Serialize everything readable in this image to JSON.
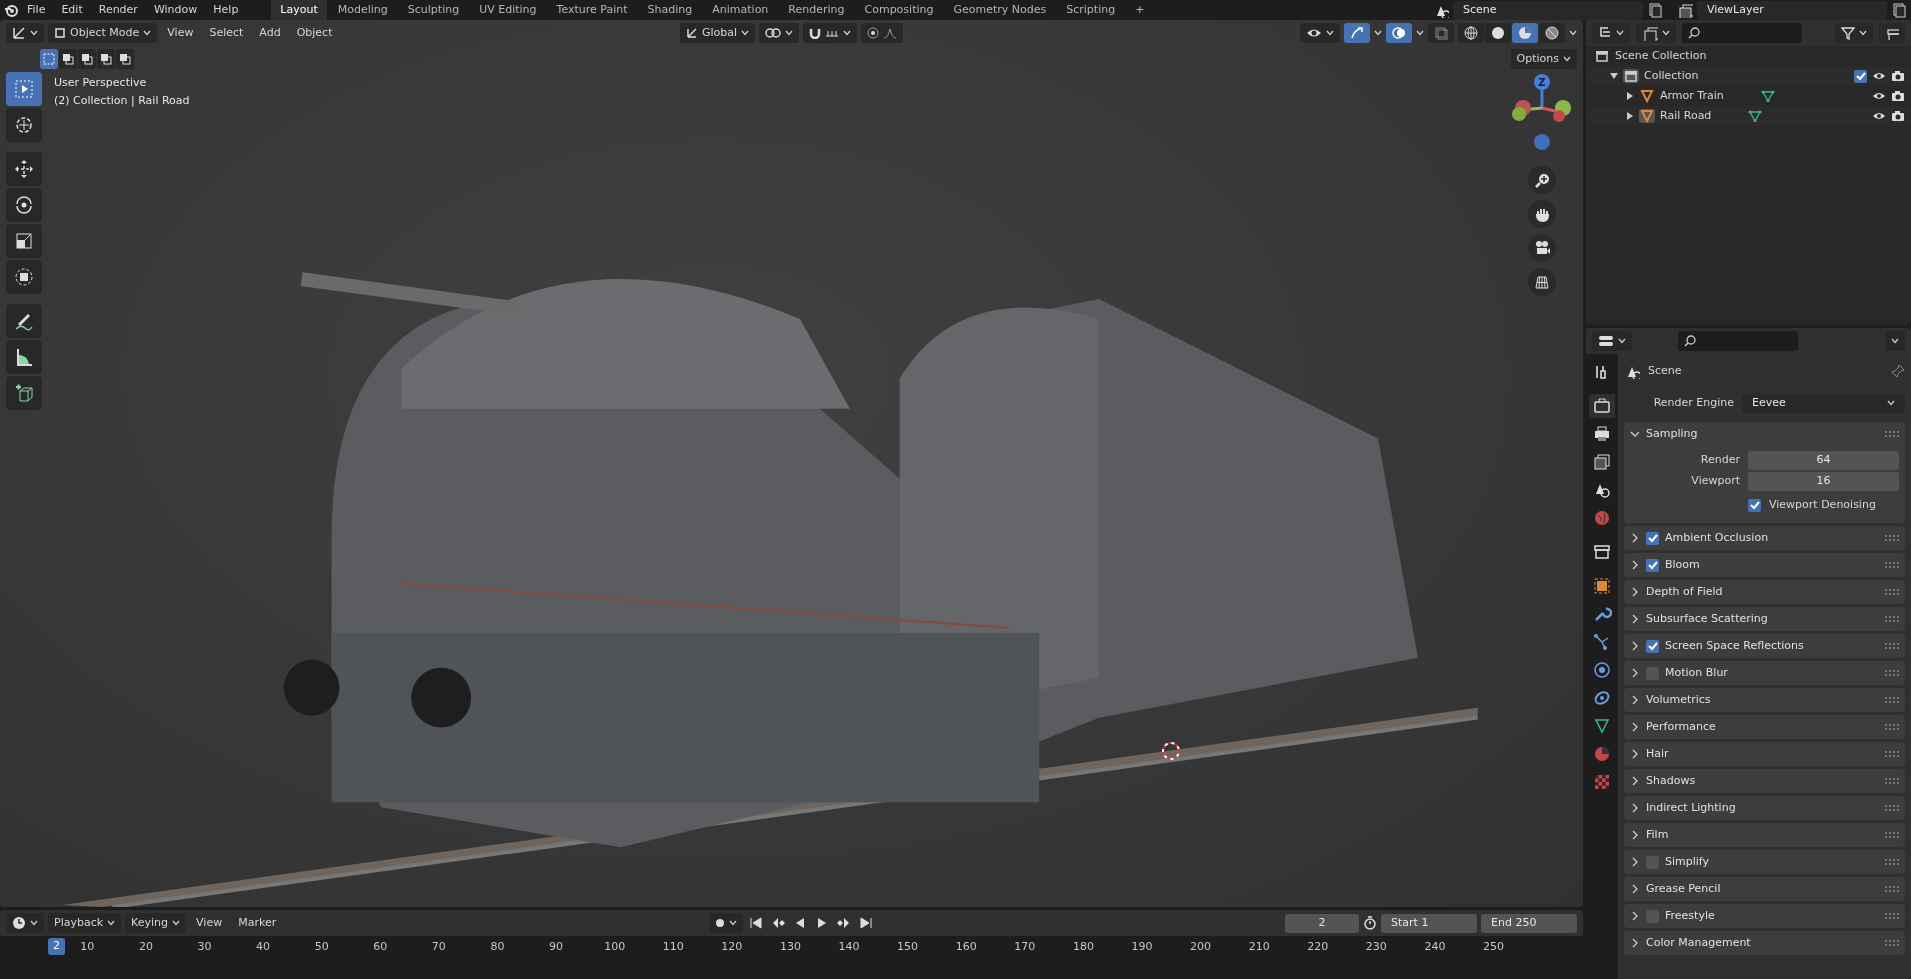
{
  "menu": [
    "File",
    "Edit",
    "Render",
    "Window",
    "Help"
  ],
  "workspaces": [
    {
      "label": "Layout",
      "selected": true
    },
    {
      "label": "Modeling",
      "selected": false
    },
    {
      "label": "Sculpting",
      "selected": false
    },
    {
      "label": "UV Editing",
      "selected": false
    },
    {
      "label": "Texture Paint",
      "selected": false
    },
    {
      "label": "Shading",
      "selected": false
    },
    {
      "label": "Animation",
      "selected": false
    },
    {
      "label": "Rendering",
      "selected": false
    },
    {
      "label": "Compositing",
      "selected": false
    },
    {
      "label": "Geometry Nodes",
      "selected": false
    },
    {
      "label": "Scripting",
      "selected": false
    }
  ],
  "add_workspace": "+",
  "scene": "Scene",
  "view_layer": "ViewLayer",
  "viewport": {
    "mode": "Object Mode",
    "menus": [
      "View",
      "Select",
      "Add",
      "Object"
    ],
    "orientation": "Global",
    "options": "Options",
    "overlay_lines": [
      "User Perspective",
      "(2) Collection | Rail Road"
    ],
    "select_modes": [
      {
        "selected": true
      },
      {
        "selected": false
      },
      {
        "selected": false
      },
      {
        "selected": false
      },
      {
        "selected": false
      }
    ],
    "gizmo_selected": true,
    "overlays_selected": true,
    "shading": [
      {
        "selected": false
      },
      {
        "selected": false
      },
      {
        "selected": true
      },
      {
        "selected": false
      }
    ],
    "tools": [
      {
        "kind": "select",
        "selected": true
      },
      {
        "kind": "cursor",
        "selected": false
      },
      {
        "kind": "move",
        "selected": false
      },
      {
        "kind": "rotate",
        "selected": false
      },
      {
        "kind": "scale",
        "selected": false
      },
      {
        "kind": "transform",
        "selected": false
      },
      {
        "kind": "annotate",
        "selected": false
      },
      {
        "kind": "measure",
        "selected": false
      },
      {
        "kind": "addcube",
        "selected": false
      }
    ],
    "gizmo_axis": "Z"
  },
  "outliner": {
    "items": [
      {
        "label": "Scene Collection",
        "children": [
          {
            "label": "Collection",
            "expanded": true,
            "checked": true,
            "children": [
              {
                "label": "Armor Train",
                "expanded": false,
                "selected": false
              },
              {
                "label": "Rail Road",
                "expanded": false,
                "selected": true
              }
            ]
          }
        ]
      }
    ]
  },
  "properties": {
    "tabs": [
      {
        "kind": "tool",
        "selected": false
      },
      {
        "kind": "render",
        "selected": true
      },
      {
        "kind": "output",
        "selected": false
      },
      {
        "kind": "viewlayer",
        "selected": false
      },
      {
        "kind": "scene",
        "selected": false
      },
      {
        "kind": "world",
        "selected": false
      },
      {
        "kind": "collection",
        "selected": false
      },
      {
        "kind": "object",
        "selected": false
      },
      {
        "kind": "modifier",
        "selected": false
      },
      {
        "kind": "particles",
        "selected": false
      },
      {
        "kind": "physics",
        "selected": false
      },
      {
        "kind": "constraint",
        "selected": false
      },
      {
        "kind": "data",
        "selected": false
      },
      {
        "kind": "material",
        "selected": false
      },
      {
        "kind": "texture",
        "selected": false
      }
    ],
    "context": "Scene",
    "render_engine": {
      "label": "Render Engine",
      "value": "Eevee"
    },
    "panels": [
      {
        "title": "Sampling",
        "expanded": true,
        "fields": [
          {
            "label": "Render",
            "value": "64"
          },
          {
            "label": "Viewport",
            "value": "16"
          }
        ],
        "option": {
          "label": "Viewport Denoising",
          "checked": true
        }
      },
      {
        "title": "Ambient Occlusion",
        "expanded": false,
        "checked": true
      },
      {
        "title": "Bloom",
        "expanded": false,
        "checked": true
      },
      {
        "title": "Depth of Field",
        "expanded": false
      },
      {
        "title": "Subsurface Scattering",
        "expanded": false
      },
      {
        "title": "Screen Space Reflections",
        "expanded": false,
        "checked": true
      },
      {
        "title": "Motion Blur",
        "expanded": false,
        "checked": false
      },
      {
        "title": "Volumetrics",
        "expanded": false
      },
      {
        "title": "Performance",
        "expanded": false
      },
      {
        "title": "Hair",
        "expanded": false
      },
      {
        "title": "Shadows",
        "expanded": false
      },
      {
        "title": "Indirect Lighting",
        "expanded": false
      },
      {
        "title": "Film",
        "expanded": false
      },
      {
        "title": "Simplify",
        "expanded": false,
        "checked": false
      },
      {
        "title": "Grease Pencil",
        "expanded": false
      },
      {
        "title": "Freestyle",
        "expanded": false,
        "checked": false
      },
      {
        "title": "Color Management",
        "expanded": false
      }
    ]
  },
  "timeline": {
    "menus": [
      "Playback",
      "Keying",
      "View",
      "Marker"
    ],
    "current_frame": "2",
    "start": {
      "label": "Start",
      "value": "1"
    },
    "end": {
      "label": "End",
      "value": "250"
    },
    "ruler": [
      "10",
      "20",
      "30",
      "40",
      "50",
      "60",
      "70",
      "80",
      "90",
      "100",
      "110",
      "120",
      "130",
      "140",
      "150",
      "160",
      "170",
      "180",
      "190",
      "200",
      "210",
      "220",
      "230",
      "240",
      "250"
    ],
    "playhead": "2"
  }
}
